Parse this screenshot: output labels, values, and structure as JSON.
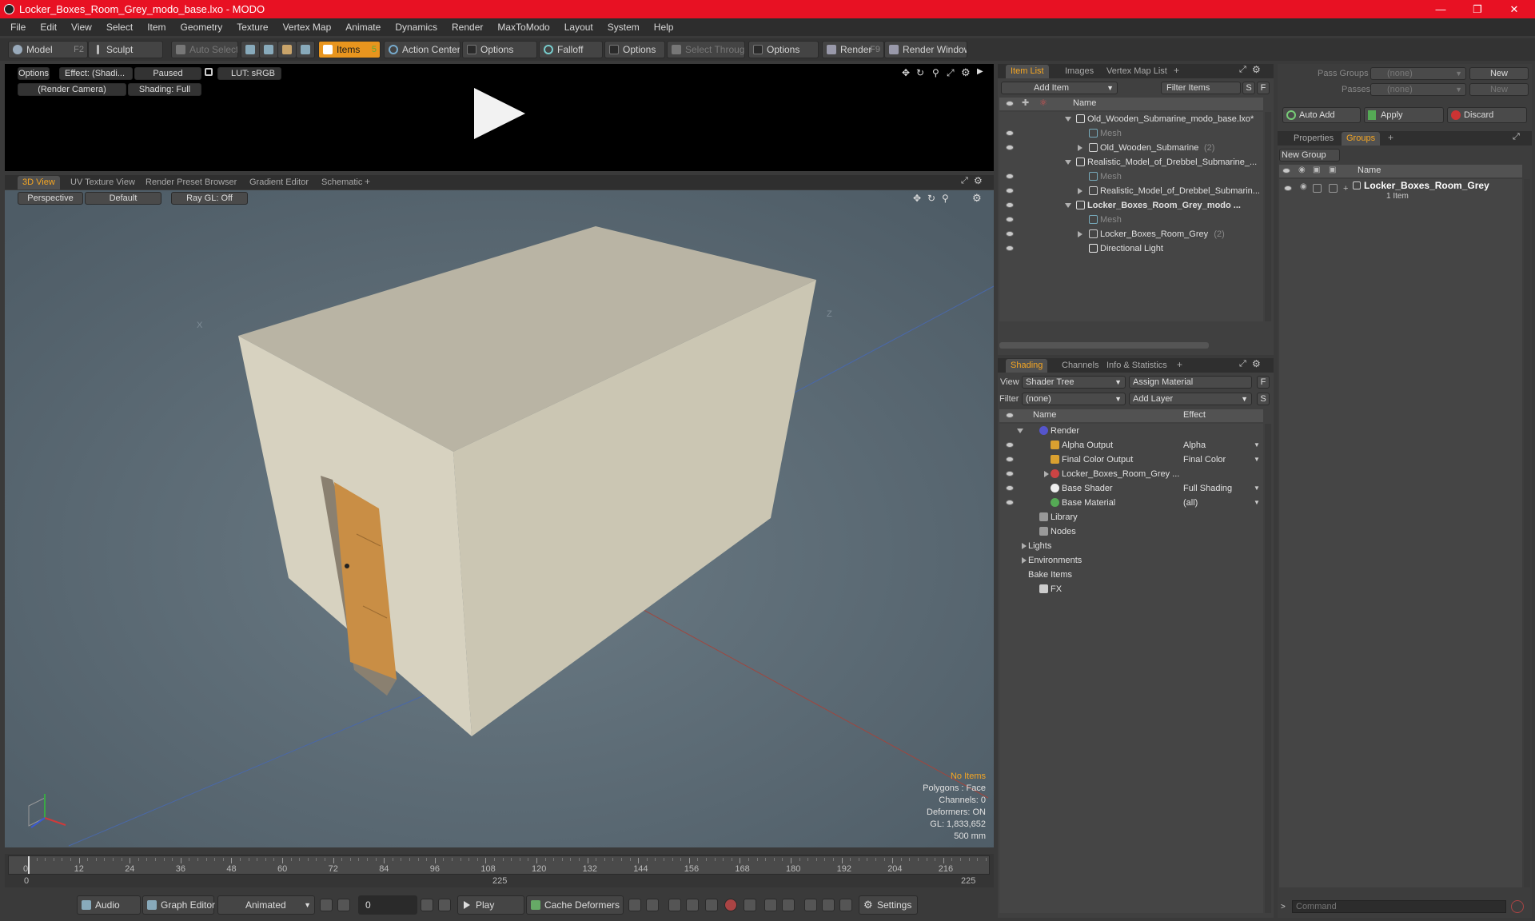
{
  "window": {
    "title": "Locker_Boxes_Room_Grey_modo_base.lxo - MODO"
  },
  "menu": [
    "File",
    "Edit",
    "View",
    "Select",
    "Item",
    "Geometry",
    "Texture",
    "Vertex Map",
    "Animate",
    "Dynamics",
    "Render",
    "MaxToModo",
    "Layout",
    "System",
    "Help"
  ],
  "toolbar": {
    "model": "Model",
    "model_key": "F2",
    "sculpt": "Sculpt",
    "auto_select": "Auto Select",
    "items": "Items",
    "items_key": "5",
    "action_center": "Action Center",
    "options1": "Options",
    "falloff": "Falloff",
    "options2": "Options",
    "select_through": "Select Through",
    "options3": "Options",
    "render": "Render",
    "render_key": "F9",
    "render_window": "Render Window"
  },
  "preview": {
    "options": "Options",
    "effect": "Effect: (Shadi...",
    "paused": "Paused",
    "lut": "LUT: sRGB",
    "camera": "(Render Camera)",
    "shading": "Shading: Full"
  },
  "view_tabs": [
    "3D View",
    "UV Texture View",
    "Render Preset Browser",
    "Gradient Editor",
    "Schematic"
  ],
  "viewport": {
    "perspective": "Perspective",
    "default": "Default",
    "raygl": "Ray GL: Off",
    "axis_x": "X",
    "axis_z": "Z",
    "stats": {
      "no_items": "No Items",
      "polygons": "Polygons : Face",
      "channels": "Channels: 0",
      "deformers": "Deformers: ON",
      "gl": "GL: 1,833,652",
      "scale": "500 mm"
    },
    "colors": {
      "stats_highlight": "#f5a623",
      "box_top": "#b9b4a4",
      "box_front": "#d7d2c0",
      "box_side": "#cbc6b3",
      "door": "#c98e45"
    }
  },
  "timeline": {
    "ticks": [
      "0",
      "12",
      "24",
      "36",
      "48",
      "60",
      "72",
      "84",
      "96",
      "108",
      "120",
      "132",
      "144",
      "156",
      "168",
      "180",
      "192",
      "204",
      "216"
    ],
    "start": "0",
    "mid": "225",
    "end": "225"
  },
  "bottombar": {
    "audio": "Audio",
    "graph_editor": "Graph Editor",
    "animated": "Animated",
    "frame": "0",
    "play": "Play",
    "cache_deformers": "Cache Deformers",
    "settings": "Settings"
  },
  "item_list": {
    "tabs": [
      "Item List",
      "Images",
      "Vertex Map List"
    ],
    "add_item": "Add Item",
    "filter_items": "Filter Items",
    "s": "S",
    "f": "F",
    "col_name": "Name",
    "rows": [
      {
        "label": "Old_Wooden_Submarine_modo_base.lxo*"
      },
      {
        "label": "Mesh"
      },
      {
        "label": "Old_Wooden_Submarine",
        "count": "(2)"
      },
      {
        "label": "Realistic_Model_of_Drebbel_Submarine_..."
      },
      {
        "label": "Mesh"
      },
      {
        "label": "Realistic_Model_of_Drebbel_Submarin..."
      },
      {
        "label": "Locker_Boxes_Room_Grey_modo ..."
      },
      {
        "label": "Mesh"
      },
      {
        "label": "Locker_Boxes_Room_Grey",
        "count": "(2)"
      },
      {
        "label": "Directional Light"
      }
    ]
  },
  "shading": {
    "tabs": [
      "Shading",
      "Channels",
      "Info & Statistics"
    ],
    "view_label": "View",
    "view_value": "Shader Tree",
    "assign_material": "Assign Material",
    "filter_label": "Filter",
    "filter_value": "(none)",
    "add_layer": "Add Layer",
    "f": "F",
    "s": "S",
    "col_name": "Name",
    "col_effect": "Effect",
    "rows": [
      {
        "name": "Render",
        "effect": ""
      },
      {
        "name": "Alpha Output",
        "effect": "Alpha"
      },
      {
        "name": "Final Color Output",
        "effect": "Final Color"
      },
      {
        "name": "Locker_Boxes_Room_Grey ...",
        "effect": ""
      },
      {
        "name": "Base Shader",
        "effect": "Full Shading"
      },
      {
        "name": "Base Material",
        "effect": "(all)"
      },
      {
        "name": "Library",
        "effect": ""
      },
      {
        "name": "Nodes",
        "effect": ""
      },
      {
        "name": "Lights",
        "effect": ""
      },
      {
        "name": "Environments",
        "effect": ""
      },
      {
        "name": "Bake Items",
        "effect": ""
      },
      {
        "name": "FX",
        "effect": ""
      }
    ]
  },
  "groups": {
    "pass_groups": "Pass Groups",
    "pass_value": "(none)",
    "new1": "New",
    "passes": "Passes",
    "passes_value": "(none)",
    "new2": "New",
    "auto_add": "Auto Add",
    "apply": "Apply",
    "discard": "Discard",
    "tabs": [
      "Properties",
      "Groups"
    ],
    "new_group": "New Group",
    "col_name": "Name",
    "item_name": "Locker_Boxes_Room_Grey",
    "item_sub": "1 Item",
    "command_placeholder": "Command"
  }
}
